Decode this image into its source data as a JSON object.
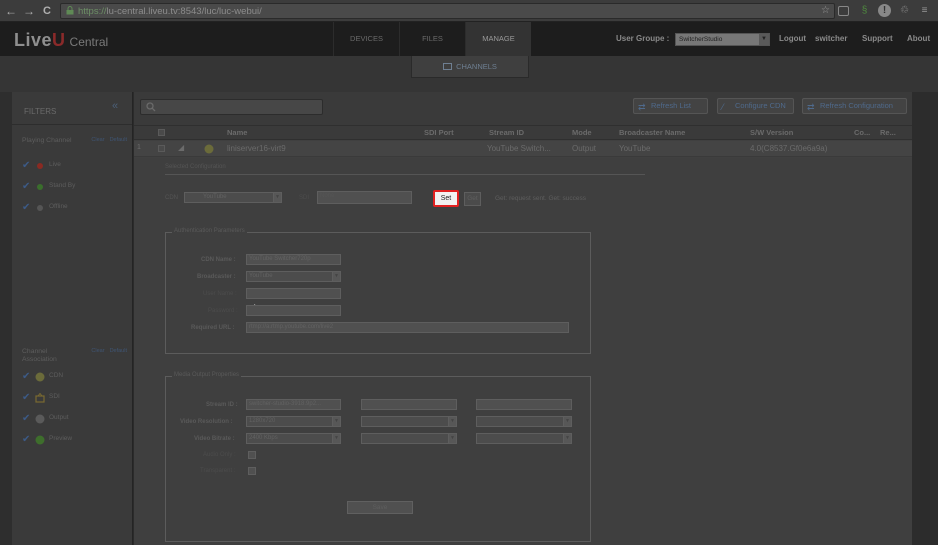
{
  "browser": {
    "back": "←",
    "forward": "→",
    "reload": "C",
    "url_secure": "https://",
    "url_host": "lu-central.liveu.tv",
    "url_rest": ":8543/luc/luc-webui/"
  },
  "header": {
    "logo_brand_a": "Live",
    "logo_brand_b": "U",
    "logo_product": "Central",
    "tabs": [
      {
        "label": "DEVICES"
      },
      {
        "label": "FILES"
      },
      {
        "label": "MANAGE"
      }
    ],
    "user_group_label": "User Groupe :",
    "user_group_value": "SwitcherStudio",
    "logout": "Logout",
    "username": "switcher",
    "support": "Support",
    "about": "About"
  },
  "subheader": {
    "tab": "CHANNELS"
  },
  "filters": {
    "title": "FILTERS",
    "playing_channel": {
      "title": "Playing Channel",
      "clear": "Clear",
      "default": "Default",
      "items": [
        {
          "label": "Live",
          "color": "#b3261e"
        },
        {
          "label": "Stand By",
          "color": "#3d8a2c"
        },
        {
          "label": "Offline",
          "color": "#6b6b6b"
        }
      ]
    },
    "channel_association": {
      "title": "Channel Association",
      "clear": "Clear",
      "default": "Default",
      "items": [
        {
          "label": "CDN",
          "icon": "cdn-icon"
        },
        {
          "label": "SDI",
          "icon": "sdi-icon"
        },
        {
          "label": "Output",
          "icon": "output-icon"
        },
        {
          "label": "Preview",
          "icon": "preview-icon"
        }
      ]
    }
  },
  "toolbar": {
    "search_placeholder": "",
    "refresh_list": "Refresh List",
    "configure_cdn": "Configure CDN",
    "refresh_configuration": "Refresh Configuration"
  },
  "table": {
    "columns": [
      "Name",
      "SDI Port",
      "Stream ID",
      "Mode",
      "Broadcaster Name",
      "S/W Version",
      "Co...",
      "Re..."
    ],
    "row": {
      "index": "1",
      "name": "liniserver16-virt9",
      "sdi_port": "",
      "stream_id": "YouTube Switch...",
      "mode": "Output",
      "broadcaster": "YouTube",
      "sw_version": "4.0(C8537.Gf0e6a9a)"
    }
  },
  "config": {
    "section_label": "Selected Configuration",
    "cdn_label": "CDN",
    "cdn_value": "YouTube",
    "sdi_label": "SDI",
    "sdi_placeholder": "None",
    "set_label": "Set",
    "get_label": "Get",
    "status": "Get: request sent. Get: success",
    "auth": {
      "legend": "Authentication Parameters",
      "cdn_name_label": "CDN Name :",
      "cdn_name_value": "YouTube Switcher720p",
      "broadcaster_label": "Broadcaster :",
      "broadcaster_value": "YouTube",
      "username_label": "User Name :",
      "password_label": "Password :",
      "required_url_label": "Required URL :",
      "required_url_value": "rtmp://a.rtmp.youtube.com/live2"
    },
    "media": {
      "legend": "Media Output Properties",
      "stream_id_label": "Stream ID :",
      "stream_id_value": "switcher-studio-3918.9p2...",
      "video_resolution_label": "Video Resolution :",
      "video_resolution_value": "1280x720",
      "video_bitrate_label": "Video Bitrate :",
      "video_bitrate_value": "2400 Kbps",
      "audio_only_label": "Audio Only :",
      "transparent_label": "Transparent :"
    },
    "save_label": "Save"
  }
}
